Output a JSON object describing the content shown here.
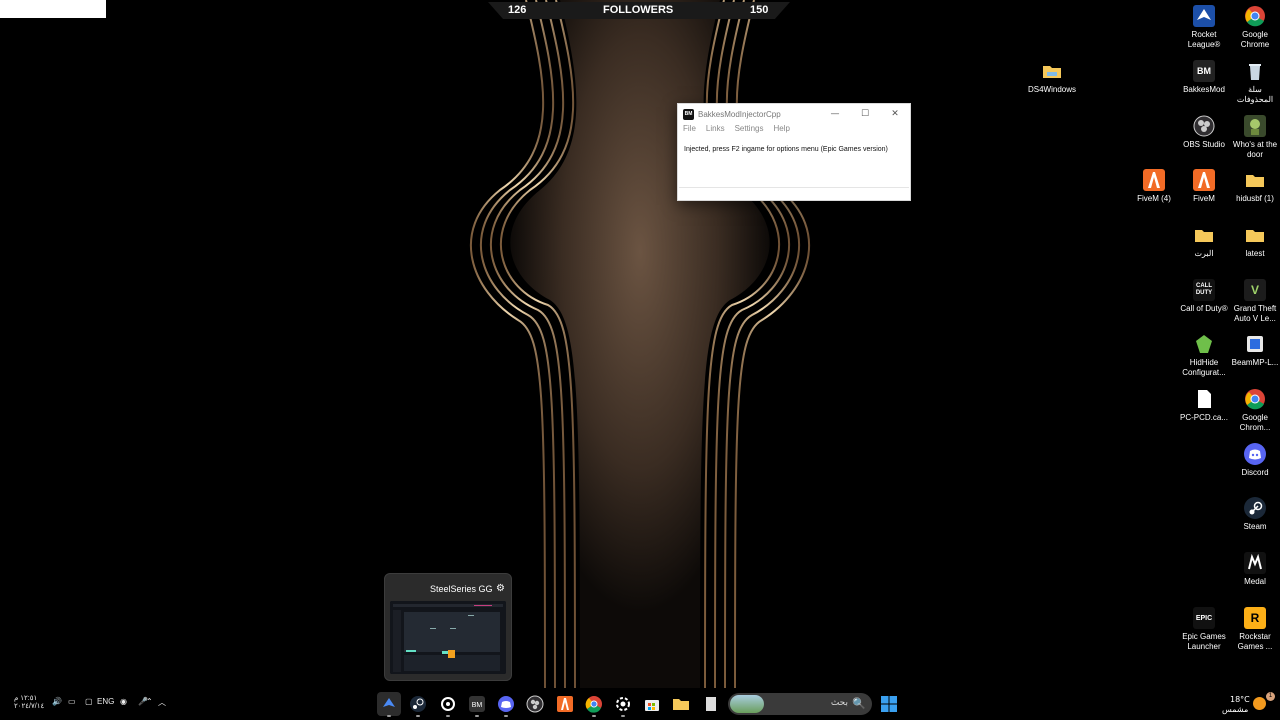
{
  "overlay": {
    "left_count": "126",
    "label": "FOLLOWERS",
    "right_count": "150"
  },
  "desktop_icons": [
    {
      "id": "rocket",
      "label": "Rocket League®",
      "icon": "rocket-league-icon"
    },
    {
      "id": "chrome1",
      "label": "Google Chrome",
      "icon": "chrome-icon"
    },
    {
      "id": "ds4",
      "label": "DS4Windows",
      "icon": "folder-icon"
    },
    {
      "id": "bakkes",
      "label": "BakkesMod",
      "icon": "bakkesmod-icon"
    },
    {
      "id": "bin",
      "label": "سلة المحذوفات",
      "icon": "recycle-bin-icon"
    },
    {
      "id": "obs",
      "label": "OBS Studio",
      "icon": "obs-icon"
    },
    {
      "id": "whos",
      "label": "Who's at the door",
      "icon": "game-icon"
    },
    {
      "id": "fivem4",
      "label": "FiveM (4)",
      "icon": "fivem-icon"
    },
    {
      "id": "fivem",
      "label": "FiveM",
      "icon": "fivem-icon"
    },
    {
      "id": "hidusbf",
      "label": "hidusbf (1)",
      "icon": "folder-icon"
    },
    {
      "id": "albert",
      "label": "البرت",
      "icon": "folder-icon"
    },
    {
      "id": "latest",
      "label": "latest",
      "icon": "folder-icon"
    },
    {
      "id": "cod",
      "label": "Call of Duty®",
      "icon": "call-of-duty-icon"
    },
    {
      "id": "gta",
      "label": "Grand Theft Auto V Le...",
      "icon": "gta-icon"
    },
    {
      "id": "hidhide",
      "label": "HidHide Configurat...",
      "icon": "hidhide-icon"
    },
    {
      "id": "beammp",
      "label": "BeamMP-L...",
      "icon": "beammp-icon"
    },
    {
      "id": "pcpcd",
      "label": "PC-PCD.ca...",
      "icon": "file-icon"
    },
    {
      "id": "chrome2",
      "label": "Google Chrom...",
      "icon": "chrome-icon"
    },
    {
      "id": "discord",
      "label": "Discord",
      "icon": "discord-icon"
    },
    {
      "id": "steam",
      "label": "Steam",
      "icon": "steam-icon"
    },
    {
      "id": "medal",
      "label": "Medal",
      "icon": "medal-icon"
    },
    {
      "id": "epic",
      "label": "Epic Games Launcher",
      "icon": "epic-games-icon"
    },
    {
      "id": "rockstar",
      "label": "Rockstar Games ...",
      "icon": "rockstar-icon"
    }
  ],
  "window": {
    "icon_text": "BM",
    "title": "BakkesModInjectorCpp",
    "minimize": "—",
    "maximize": "☐",
    "close": "✕",
    "menu": [
      "File",
      "Links",
      "Settings",
      "Help"
    ],
    "message": "Injected, press F2 ingame for options menu (Epic Games version)"
  },
  "preview": {
    "title": "SteelSeries GG"
  },
  "taskbar": {
    "apps": [
      "rocket-league",
      "steam",
      "steelseries",
      "bakkesmod",
      "discord",
      "obs",
      "fivem",
      "chrome",
      "steelseries-gg",
      "microsoft-store",
      "file-explorer",
      "notepad"
    ],
    "search_placeholder": "بحث",
    "weather_temp": "18°C",
    "weather_desc": "مشمس",
    "time": "١٢:٥١ م",
    "date": "٢٠٢٤/٧/١٤",
    "language": "ENG",
    "notification_count": "1"
  }
}
